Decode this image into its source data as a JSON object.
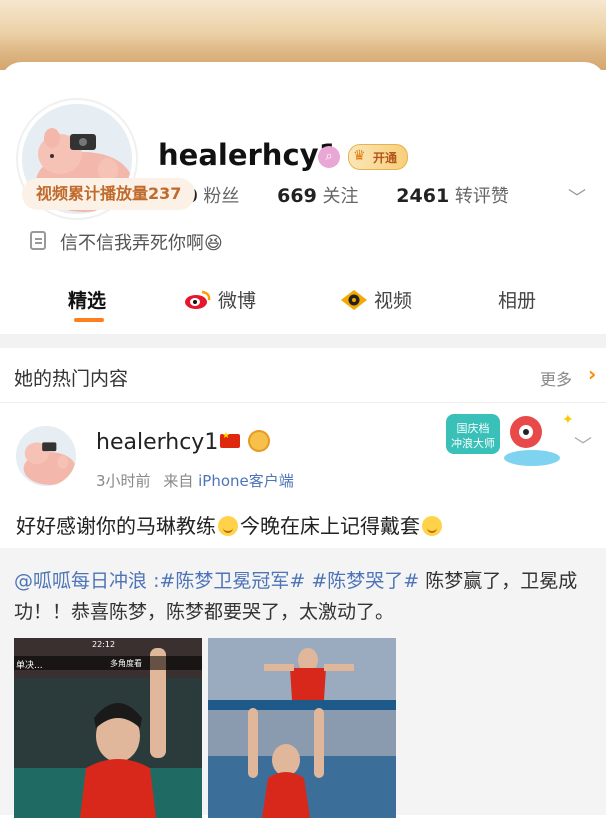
{
  "profile": {
    "username": "healerhcy1",
    "vip_label": "开通",
    "stats": [
      {
        "value": "590",
        "label": "粉丝"
      },
      {
        "value": "669",
        "label": "关注"
      },
      {
        "value": "2461",
        "label": "转评赞"
      }
    ],
    "video_plays": "视频累计播放量237",
    "bio": "信不信我弄死你啊😆"
  },
  "tabs": [
    {
      "label": "精选"
    },
    {
      "label": "微博"
    },
    {
      "label": "视频"
    },
    {
      "label": "相册"
    }
  ],
  "hot_section": {
    "title": "她的热门内容",
    "more": "更多"
  },
  "post": {
    "username": "healerhcy1",
    "time": "3小时前",
    "source_prefix": "来自",
    "source": "iPhone客户端",
    "text_part1": "好好感谢你的马琳教练",
    "text_part2": "今晚在床上记得戴套",
    "sticker_text": "国庆档冲浪大师",
    "repost": {
      "mention": "@呱呱每日冲浪",
      "colon": ":",
      "tag1": "#陈梦卫冕冠军#",
      "tag2": "#陈梦哭了#",
      "body": "陈梦赢了，卫冕成功！！恭喜陈梦，陈梦都要哭了，太激动了。"
    },
    "image1": {
      "clock": "22:12",
      "ticker": "单决...",
      "badge": "多角度看"
    },
    "image2": {}
  },
  "colors": {
    "accent": "#ff7e1f",
    "link": "#4d74b9",
    "pill_text": "#c06a2b"
  }
}
